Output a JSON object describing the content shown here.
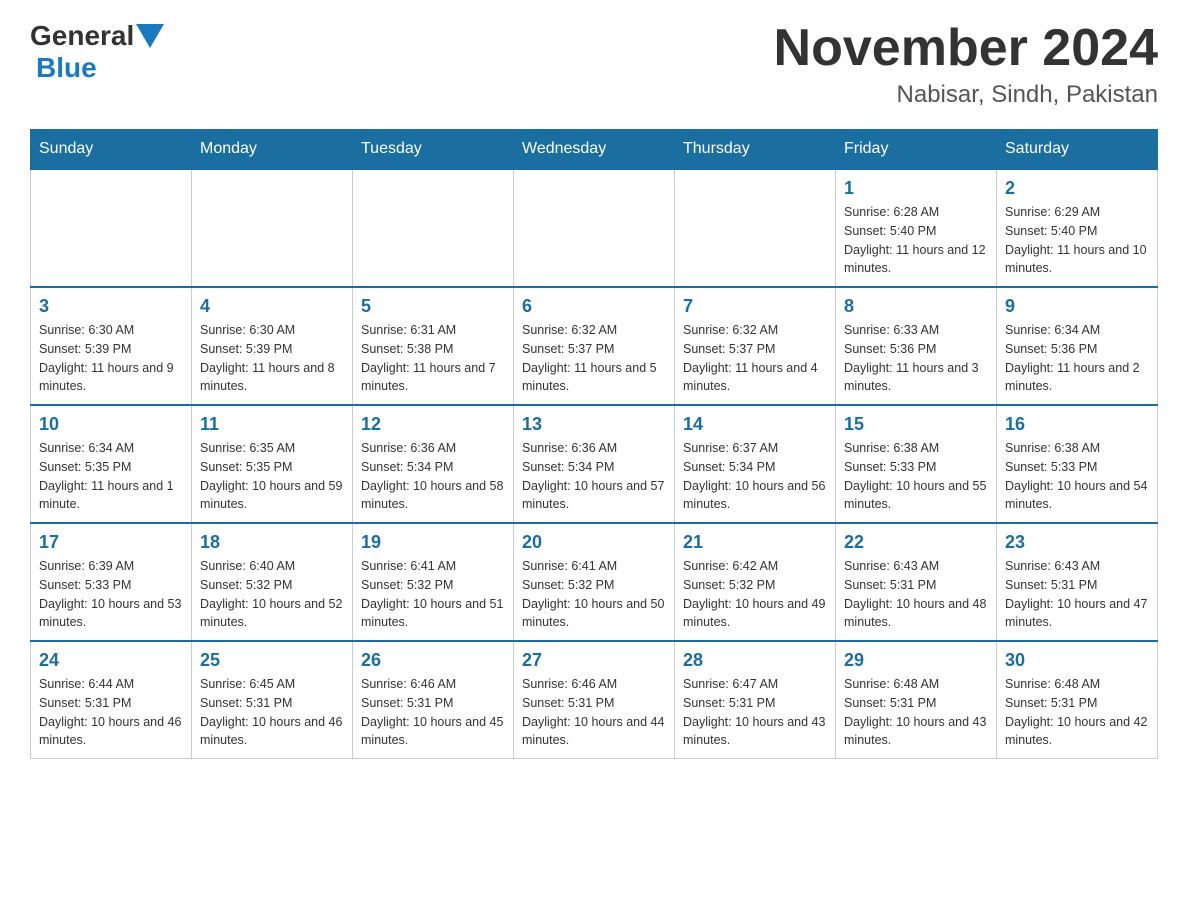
{
  "header": {
    "logo_general": "General",
    "logo_blue": "Blue",
    "title": "November 2024",
    "subtitle": "Nabisar, Sindh, Pakistan"
  },
  "weekdays": [
    "Sunday",
    "Monday",
    "Tuesday",
    "Wednesday",
    "Thursday",
    "Friday",
    "Saturday"
  ],
  "weeks": [
    [
      {
        "day": "",
        "sunrise": "",
        "sunset": "",
        "daylight": ""
      },
      {
        "day": "",
        "sunrise": "",
        "sunset": "",
        "daylight": ""
      },
      {
        "day": "",
        "sunrise": "",
        "sunset": "",
        "daylight": ""
      },
      {
        "day": "",
        "sunrise": "",
        "sunset": "",
        "daylight": ""
      },
      {
        "day": "",
        "sunrise": "",
        "sunset": "",
        "daylight": ""
      },
      {
        "day": "1",
        "sunrise": "Sunrise: 6:28 AM",
        "sunset": "Sunset: 5:40 PM",
        "daylight": "Daylight: 11 hours and 12 minutes."
      },
      {
        "day": "2",
        "sunrise": "Sunrise: 6:29 AM",
        "sunset": "Sunset: 5:40 PM",
        "daylight": "Daylight: 11 hours and 10 minutes."
      }
    ],
    [
      {
        "day": "3",
        "sunrise": "Sunrise: 6:30 AM",
        "sunset": "Sunset: 5:39 PM",
        "daylight": "Daylight: 11 hours and 9 minutes."
      },
      {
        "day": "4",
        "sunrise": "Sunrise: 6:30 AM",
        "sunset": "Sunset: 5:39 PM",
        "daylight": "Daylight: 11 hours and 8 minutes."
      },
      {
        "day": "5",
        "sunrise": "Sunrise: 6:31 AM",
        "sunset": "Sunset: 5:38 PM",
        "daylight": "Daylight: 11 hours and 7 minutes."
      },
      {
        "day": "6",
        "sunrise": "Sunrise: 6:32 AM",
        "sunset": "Sunset: 5:37 PM",
        "daylight": "Daylight: 11 hours and 5 minutes."
      },
      {
        "day": "7",
        "sunrise": "Sunrise: 6:32 AM",
        "sunset": "Sunset: 5:37 PM",
        "daylight": "Daylight: 11 hours and 4 minutes."
      },
      {
        "day": "8",
        "sunrise": "Sunrise: 6:33 AM",
        "sunset": "Sunset: 5:36 PM",
        "daylight": "Daylight: 11 hours and 3 minutes."
      },
      {
        "day": "9",
        "sunrise": "Sunrise: 6:34 AM",
        "sunset": "Sunset: 5:36 PM",
        "daylight": "Daylight: 11 hours and 2 minutes."
      }
    ],
    [
      {
        "day": "10",
        "sunrise": "Sunrise: 6:34 AM",
        "sunset": "Sunset: 5:35 PM",
        "daylight": "Daylight: 11 hours and 1 minute."
      },
      {
        "day": "11",
        "sunrise": "Sunrise: 6:35 AM",
        "sunset": "Sunset: 5:35 PM",
        "daylight": "Daylight: 10 hours and 59 minutes."
      },
      {
        "day": "12",
        "sunrise": "Sunrise: 6:36 AM",
        "sunset": "Sunset: 5:34 PM",
        "daylight": "Daylight: 10 hours and 58 minutes."
      },
      {
        "day": "13",
        "sunrise": "Sunrise: 6:36 AM",
        "sunset": "Sunset: 5:34 PM",
        "daylight": "Daylight: 10 hours and 57 minutes."
      },
      {
        "day": "14",
        "sunrise": "Sunrise: 6:37 AM",
        "sunset": "Sunset: 5:34 PM",
        "daylight": "Daylight: 10 hours and 56 minutes."
      },
      {
        "day": "15",
        "sunrise": "Sunrise: 6:38 AM",
        "sunset": "Sunset: 5:33 PM",
        "daylight": "Daylight: 10 hours and 55 minutes."
      },
      {
        "day": "16",
        "sunrise": "Sunrise: 6:38 AM",
        "sunset": "Sunset: 5:33 PM",
        "daylight": "Daylight: 10 hours and 54 minutes."
      }
    ],
    [
      {
        "day": "17",
        "sunrise": "Sunrise: 6:39 AM",
        "sunset": "Sunset: 5:33 PM",
        "daylight": "Daylight: 10 hours and 53 minutes."
      },
      {
        "day": "18",
        "sunrise": "Sunrise: 6:40 AM",
        "sunset": "Sunset: 5:32 PM",
        "daylight": "Daylight: 10 hours and 52 minutes."
      },
      {
        "day": "19",
        "sunrise": "Sunrise: 6:41 AM",
        "sunset": "Sunset: 5:32 PM",
        "daylight": "Daylight: 10 hours and 51 minutes."
      },
      {
        "day": "20",
        "sunrise": "Sunrise: 6:41 AM",
        "sunset": "Sunset: 5:32 PM",
        "daylight": "Daylight: 10 hours and 50 minutes."
      },
      {
        "day": "21",
        "sunrise": "Sunrise: 6:42 AM",
        "sunset": "Sunset: 5:32 PM",
        "daylight": "Daylight: 10 hours and 49 minutes."
      },
      {
        "day": "22",
        "sunrise": "Sunrise: 6:43 AM",
        "sunset": "Sunset: 5:31 PM",
        "daylight": "Daylight: 10 hours and 48 minutes."
      },
      {
        "day": "23",
        "sunrise": "Sunrise: 6:43 AM",
        "sunset": "Sunset: 5:31 PM",
        "daylight": "Daylight: 10 hours and 47 minutes."
      }
    ],
    [
      {
        "day": "24",
        "sunrise": "Sunrise: 6:44 AM",
        "sunset": "Sunset: 5:31 PM",
        "daylight": "Daylight: 10 hours and 46 minutes."
      },
      {
        "day": "25",
        "sunrise": "Sunrise: 6:45 AM",
        "sunset": "Sunset: 5:31 PM",
        "daylight": "Daylight: 10 hours and 46 minutes."
      },
      {
        "day": "26",
        "sunrise": "Sunrise: 6:46 AM",
        "sunset": "Sunset: 5:31 PM",
        "daylight": "Daylight: 10 hours and 45 minutes."
      },
      {
        "day": "27",
        "sunrise": "Sunrise: 6:46 AM",
        "sunset": "Sunset: 5:31 PM",
        "daylight": "Daylight: 10 hours and 44 minutes."
      },
      {
        "day": "28",
        "sunrise": "Sunrise: 6:47 AM",
        "sunset": "Sunset: 5:31 PM",
        "daylight": "Daylight: 10 hours and 43 minutes."
      },
      {
        "day": "29",
        "sunrise": "Sunrise: 6:48 AM",
        "sunset": "Sunset: 5:31 PM",
        "daylight": "Daylight: 10 hours and 43 minutes."
      },
      {
        "day": "30",
        "sunrise": "Sunrise: 6:48 AM",
        "sunset": "Sunset: 5:31 PM",
        "daylight": "Daylight: 10 hours and 42 minutes."
      }
    ]
  ]
}
